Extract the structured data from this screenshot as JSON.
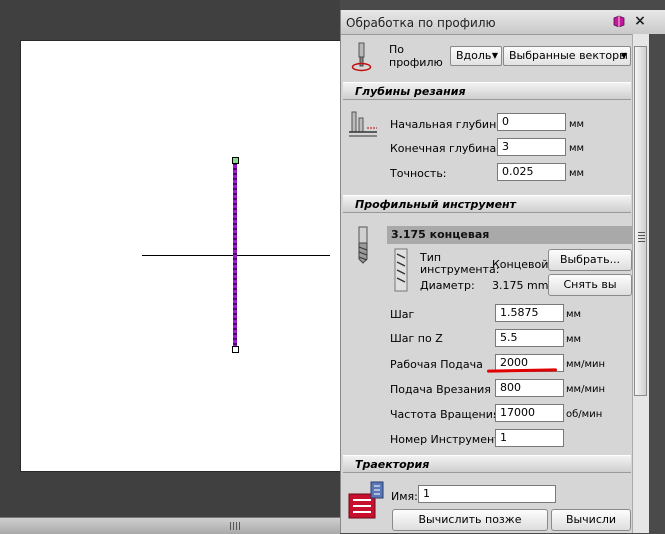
{
  "panel": {
    "title": "Обработка по профилю",
    "mode_label": "По профилю",
    "side_dropdown": "Вдоль",
    "vectors_dropdown": "Выбранные векторы"
  },
  "depths": {
    "section_title": "Глубины резания",
    "start_label": "Начальная глубина:",
    "start_value": "0",
    "start_unit": "мм",
    "end_label": "Конечная глубина:",
    "end_value": "3",
    "end_unit": "мм",
    "tol_label": "Точность:",
    "tol_value": "0.025",
    "tol_unit": "мм"
  },
  "tool": {
    "section_title": "Профильный инструмент",
    "name": "3.175 концевая",
    "type_label": "Тип инструмента:",
    "type_value": "Концевой",
    "diameter_label": "Диаметр:",
    "diameter_value": "3.175 mm",
    "select_button": "Выбрать...",
    "remove_button": "Снять вы",
    "params": [
      {
        "label": "Шаг",
        "value": "1.5875",
        "unit": "мм"
      },
      {
        "label": "Шаг по Z",
        "value": "5.5",
        "unit": "мм"
      },
      {
        "label": "Рабочая Подача",
        "value": "2000",
        "unit": "мм/мин"
      },
      {
        "label": "Подача Врезания",
        "value": "800",
        "unit": "мм/мин"
      },
      {
        "label": "Частота Вращения",
        "value": "17000",
        "unit": "об/мин"
      },
      {
        "label": "Номер Инструмента",
        "value": "1",
        "unit": ""
      }
    ]
  },
  "toolpath": {
    "section_title": "Траектория",
    "name_label": "Имя:",
    "name_value": "1",
    "calc_later_button": "Вычислить позже",
    "calc_button": "Вычисли"
  },
  "colors": {
    "highlight": "#e00000",
    "vector": "#9b1ad0"
  }
}
